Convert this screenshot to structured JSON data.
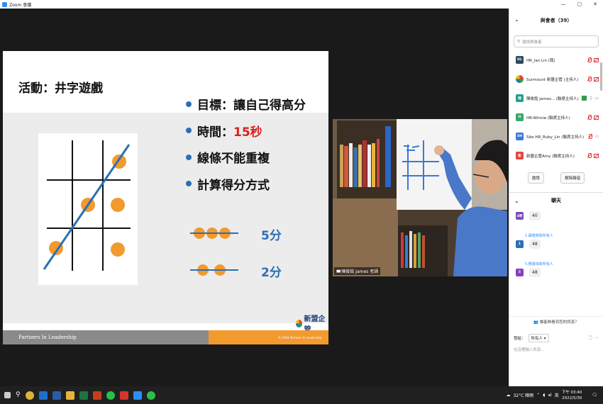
{
  "window": {
    "title": "Zoom 會議"
  },
  "slide": {
    "title": "活動：井字遊戲",
    "bullets": [
      {
        "text": "目標：讓自己得高分",
        "highlight": ""
      },
      {
        "text": "時間：",
        "highlight": "15秒"
      },
      {
        "text": "線條不能重複",
        "highlight": ""
      },
      {
        "text": "計算得分方式",
        "highlight": ""
      }
    ],
    "scores": [
      "5分",
      "2分"
    ],
    "footer_left": "Partners In Leadership",
    "footer_right": "© 2018 Partners In Leadership",
    "brand": "新盟企管",
    "colors": {
      "accent": "#2b6fb4",
      "dot": "#f29a2e",
      "highlight": "#d9201c"
    }
  },
  "video": {
    "name": "陳俊銘 James 老師"
  },
  "participants_panel": {
    "title": "與會者（39）",
    "search_placeholder": "尋找與會者",
    "participants": [
      {
        "initials": "HL",
        "name": "HR_Ian Lin (我)",
        "color": "#2e4a5e"
      },
      {
        "initials": "",
        "name": "Surmount 新盟企管 (主持人)",
        "color": "#ffffff"
      },
      {
        "initials": "陳",
        "name": "陳俊銘 James... (聯席主持人)",
        "color": "#2a9d8f"
      },
      {
        "initials": "H",
        "name": "HR-Winnie (聯席主持人)",
        "color": "#3aa86b"
      },
      {
        "initials": "SH",
        "name": "Site HR_Ruby_Lin (聯席主持人)",
        "color": "#3a7bd5"
      },
      {
        "initials": "新",
        "name": "新盟企管Amy (聯席主持人)",
        "color": "#e0483d"
      }
    ],
    "invite_label": "邀請",
    "unmute_label": "解除靜音"
  },
  "chat_panel": {
    "title": "聊天",
    "messages": [
      {
        "initials": "4明",
        "to": "",
        "text": "40",
        "color": "#7a4bb8"
      },
      {
        "initials": "1",
        "to": "1.蘇暄筑對所有人",
        "text": "48",
        "color": "#2b6fb4"
      },
      {
        "initials": "5",
        "to": "5.顏書緯對所有人",
        "text": "48",
        "color": "#8a3fbf"
      }
    ],
    "unread": "誰能夠看到您的訊息？",
    "send_to_label": "發給：",
    "send_to_value": "所有人",
    "input_placeholder": "在這裡輸入訊息..."
  },
  "taskbar": {
    "weather": "32°C 陣雨",
    "ime": "英",
    "time": "下午 03:40",
    "date": "2022/5/30"
  }
}
